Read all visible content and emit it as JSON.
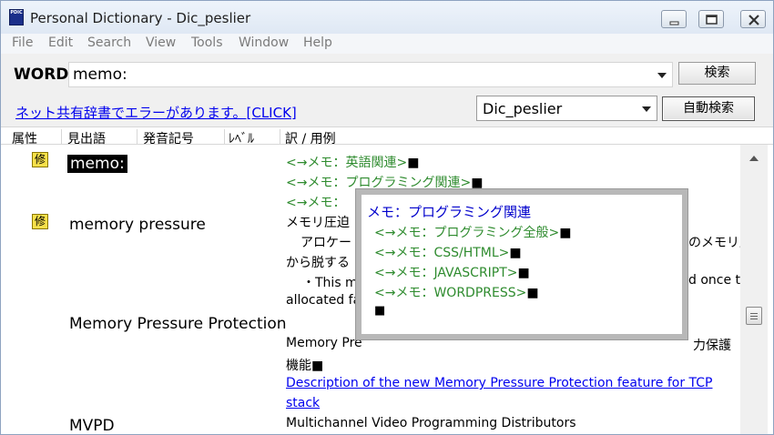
{
  "window": {
    "title": "Personal Dictionary - Dic_peslier",
    "app_icon_text": "PDIC",
    "controls": [
      "minimize-icon",
      "maximize-icon",
      "close-icon"
    ]
  },
  "menu": [
    "File",
    "Edit",
    "Search",
    "View",
    "Tools",
    "Window",
    "Help"
  ],
  "wordbar": {
    "label": "WORD",
    "value": "memo:",
    "search_button": "検索"
  },
  "bar2": {
    "error_link": "ネット共有辞書でエラーがあります。[CLICK]",
    "dictionary": "Dic_peslier",
    "auto_search_button": "自動検索"
  },
  "columns": [
    "属性",
    "見出語",
    "発音記号",
    "ﾚﾍﾞﾙ",
    "訳 / 用例"
  ],
  "entries": {
    "e1": {
      "badge": "修",
      "headword": "memo:",
      "lines": [
        "<→メモ：英語関連>",
        "<→メモ：プログラミング関連>",
        "<→メモ："
      ]
    },
    "e2": {
      "badge": "修",
      "headword": "memory pressure",
      "lines": [
        "メモリ圧迫",
        "アロケー",
        "のメモリ圧迫状態",
        "から脱する",
        "・This me",
        "d once the number of pages",
        "allocated fa"
      ]
    },
    "e3": {
      "headword": "Memory Pressure Protection",
      "lines": [
        "Memory Pre",
        "力保護",
        "機能",
        "Description of the new Memory Pressure Protection feature for TCP",
        "stack"
      ]
    },
    "e4": {
      "headword": "MVPD",
      "lines": [
        "Multichannel Video Programming Distributors"
      ]
    }
  },
  "end_mark": "■",
  "popup": {
    "title": "メモ：プログラミング関連",
    "items": [
      "<→メモ：プログラミング全般>",
      "<→メモ：CSS/HTML>",
      "<→メモ：JAVASCRIPT>",
      "<→メモ：WORDPRESS>"
    ]
  },
  "colors": {
    "link": "#0000ee",
    "green_ref": "#2e8b2e",
    "badge_bg": "#f6e04a",
    "selected_bg": "#000000"
  }
}
